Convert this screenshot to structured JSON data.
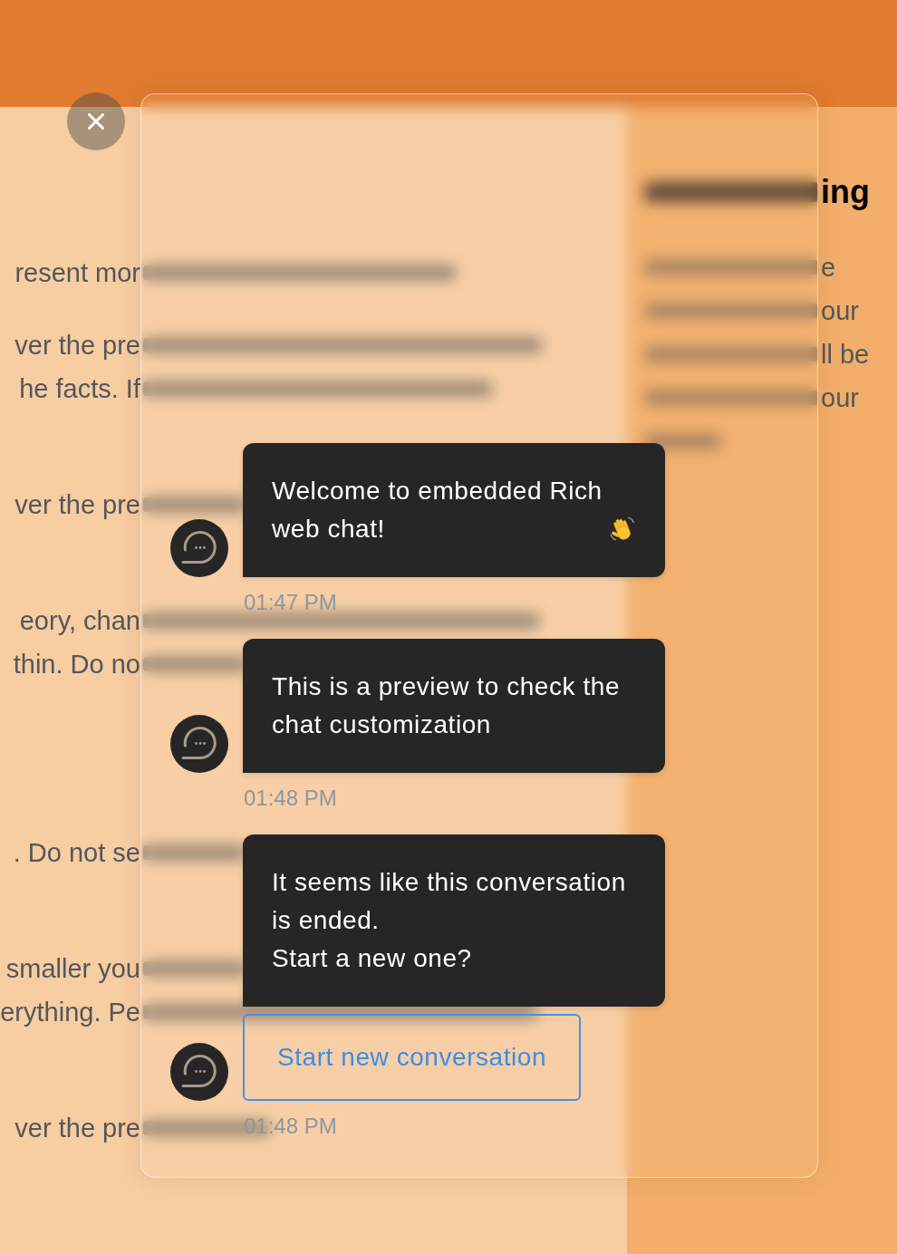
{
  "page_text": {
    "left_lines": [
      "resent mor",
      "ver the pre",
      "he facts. If",
      "ver the pre",
      "eory, chan",
      "thin. Do no",
      ". Do not se",
      "smaller you",
      "erything. Pe",
      "ver the pre"
    ],
    "right_heading": "ing",
    "right_lines": [
      "e",
      "our",
      "ll be",
      "our"
    ]
  },
  "chat": {
    "messages": [
      {
        "text": "Welcome to embedded Rich web chat!",
        "emoji": true,
        "time": "01:47 PM"
      },
      {
        "text": "This is a preview to check the chat customization",
        "emoji": false,
        "time": "01:48 PM"
      },
      {
        "text": "It seems like this conversation is ended.\nStart a new one?",
        "emoji": false,
        "action_button": "Start new conversation",
        "time": "01:48 PM"
      }
    ]
  }
}
